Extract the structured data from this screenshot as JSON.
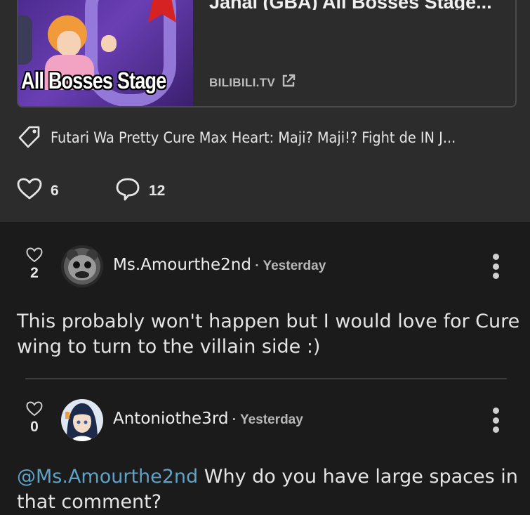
{
  "link_preview": {
    "title": "Janai (GBA) All Bosses Stage...",
    "thumbnail_caption": "All Bosses Stage",
    "source": "BILIBILI.TV",
    "external_icon": "external-link-icon"
  },
  "tag": {
    "icon": "tag-icon",
    "text": "Futari Wa Pretty Cure Max Heart: Maji? Maji!? Fight de IN J..."
  },
  "stats": {
    "likes": "6",
    "comments": "12"
  },
  "comments": [
    {
      "votes": "2",
      "username": "Ms.Amourthe2nd",
      "time": "Yesterday",
      "body": "This probably won't happen but I would love for Cure wing to turn to the villain side :)"
    },
    {
      "votes": "0",
      "username": "Antoniothe3rd",
      "time": "Yesterday",
      "mention": "@Ms.Amourthe2nd",
      "body": " Why do you have large spaces in that comment?"
    }
  ],
  "separator": " · ",
  "colors": {
    "post_bg": "#2c2c2c",
    "page_bg": "#1b1b1b",
    "mention": "#5fa2c7"
  }
}
